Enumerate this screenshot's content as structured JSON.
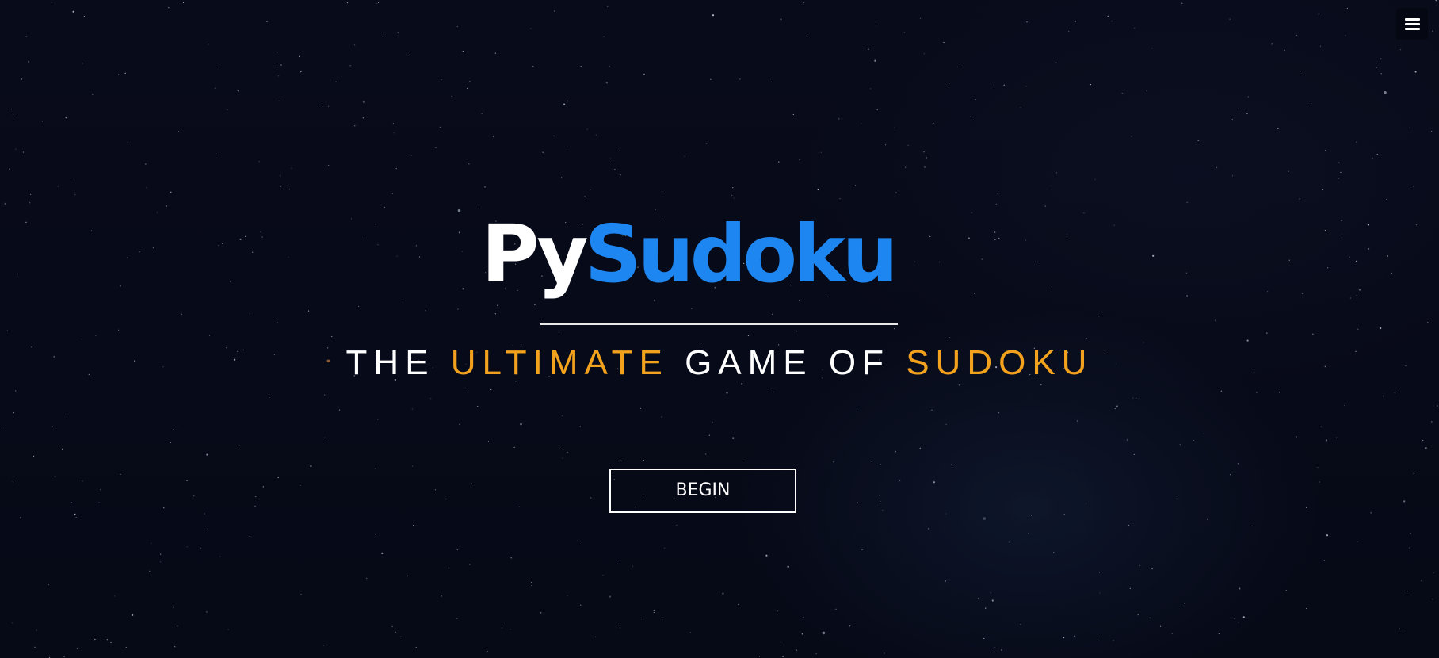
{
  "header": {
    "menu_icon": "hamburger-menu-icon"
  },
  "hero": {
    "logo_part1": "Py",
    "logo_part2": "Sudoku",
    "tagline": {
      "word1": "THE",
      "word2": "ULTIMATE",
      "word3": "GAME OF",
      "word4": "SUDOKU"
    },
    "begin_label": "BEGIN"
  },
  "colors": {
    "background": "#070a18",
    "brand_blue": "#1e86f0",
    "accent_orange": "#f3a21d",
    "text_white": "#ffffff"
  }
}
